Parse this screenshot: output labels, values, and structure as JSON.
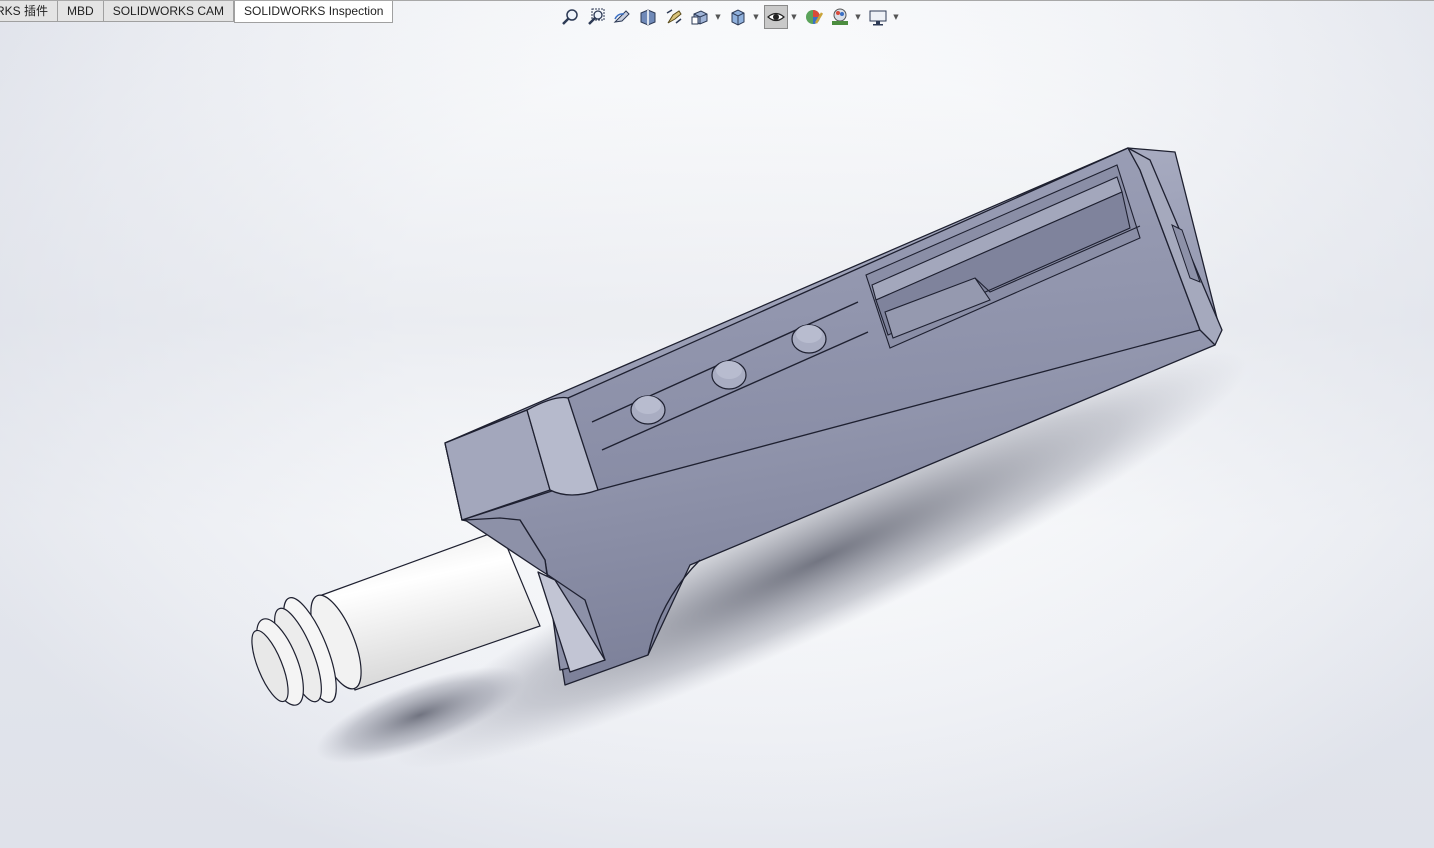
{
  "tabs": [
    {
      "label": "RKS 插件"
    },
    {
      "label": "MBD"
    },
    {
      "label": "SOLIDWORKS CAM"
    },
    {
      "label": "SOLIDWORKS Inspection"
    }
  ],
  "hud": {
    "tools": [
      {
        "icon": "zoom-to-fit-icon"
      },
      {
        "icon": "zoom-to-area-icon"
      },
      {
        "icon": "previous-view-icon"
      },
      {
        "icon": "section-view-icon"
      },
      {
        "icon": "dynamic-annotation-views-icon"
      },
      {
        "icon": "view-orientation-icon",
        "dropdown": true
      },
      {
        "icon": "display-style-icon",
        "dropdown": true
      },
      {
        "icon": "hide-show-items-icon",
        "dropdown": true,
        "active": true
      },
      {
        "icon": "edit-appearance-icon"
      },
      {
        "icon": "apply-scene-icon",
        "dropdown": true
      },
      {
        "icon": "view-settings-icon",
        "dropdown": true
      }
    ]
  },
  "colors": {
    "part_body": "#8e92a8",
    "part_light": "#aeb2c6",
    "part_dark": "#6b6f86",
    "edge": "#1e2030",
    "shaft": "#f4f4f4"
  }
}
